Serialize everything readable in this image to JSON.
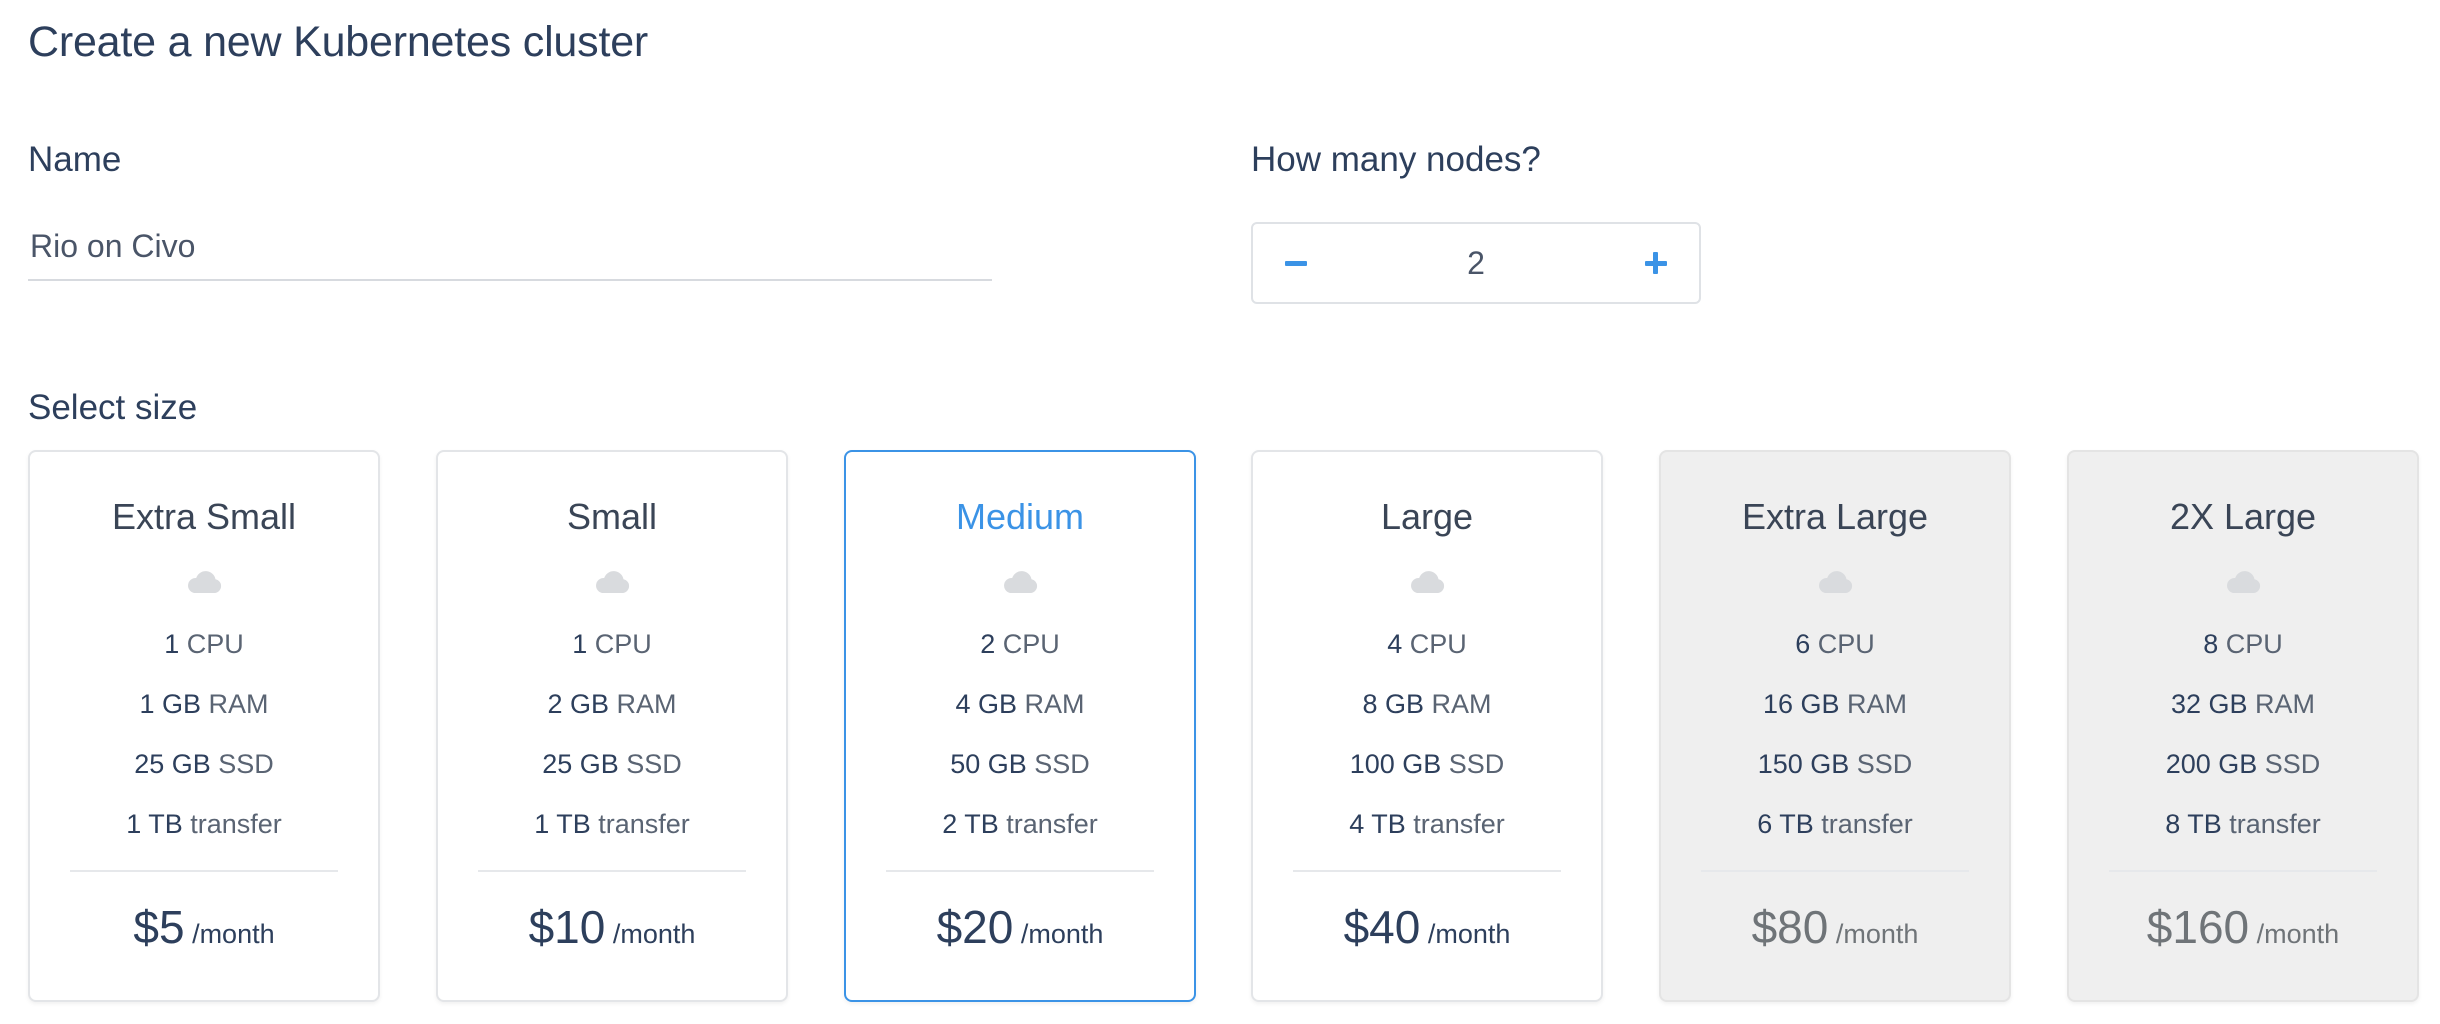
{
  "page": {
    "title": "Create a new Kubernetes cluster"
  },
  "name_field": {
    "label": "Name",
    "value": "Rio on Civo"
  },
  "nodes": {
    "label": "How many nodes?",
    "value": "2",
    "minus_icon": "minus-icon",
    "plus_icon": "plus-icon",
    "accent_color": "#3b93e6"
  },
  "sizes": {
    "label": "Select size",
    "selected": "Medium",
    "items": [
      {
        "name": "Extra Small",
        "cpu_num": "1",
        "cpu_unit": "CPU",
        "ram_num": "1 GB",
        "ram_unit": "RAM",
        "ssd_num": "25 GB",
        "ssd_unit": "SSD",
        "transfer_num": "1 TB",
        "transfer_unit": "transfer",
        "price": "$5",
        "period": "/month",
        "state": "available"
      },
      {
        "name": "Small",
        "cpu_num": "1",
        "cpu_unit": "CPU",
        "ram_num": "2 GB",
        "ram_unit": "RAM",
        "ssd_num": "25 GB",
        "ssd_unit": "SSD",
        "transfer_num": "1 TB",
        "transfer_unit": "transfer",
        "price": "$10",
        "period": "/month",
        "state": "available"
      },
      {
        "name": "Medium",
        "cpu_num": "2",
        "cpu_unit": "CPU",
        "ram_num": "4 GB",
        "ram_unit": "RAM",
        "ssd_num": "50 GB",
        "ssd_unit": "SSD",
        "transfer_num": "2 TB",
        "transfer_unit": "transfer",
        "price": "$20",
        "period": "/month",
        "state": "selected"
      },
      {
        "name": "Large",
        "cpu_num": "4",
        "cpu_unit": "CPU",
        "ram_num": "8 GB",
        "ram_unit": "RAM",
        "ssd_num": "100 GB",
        "ssd_unit": "SSD",
        "transfer_num": "4 TB",
        "transfer_unit": "transfer",
        "price": "$40",
        "period": "/month",
        "state": "available"
      },
      {
        "name": "Extra Large",
        "cpu_num": "6",
        "cpu_unit": "CPU",
        "ram_num": "16 GB",
        "ram_unit": "RAM",
        "ssd_num": "150 GB",
        "ssd_unit": "SSD",
        "transfer_num": "6 TB",
        "transfer_unit": "transfer",
        "price": "$80",
        "period": "/month",
        "state": "disabled"
      },
      {
        "name": "2X Large",
        "cpu_num": "8",
        "cpu_unit": "CPU",
        "ram_num": "32 GB",
        "ram_unit": "RAM",
        "ssd_num": "200 GB",
        "ssd_unit": "SSD",
        "transfer_num": "8 TB",
        "transfer_unit": "transfer",
        "price": "$160",
        "period": "/month",
        "state": "disabled"
      }
    ],
    "card_icon": "cloud-icon",
    "selected_color": "#3b93e6",
    "disabled_background": "#efefef"
  }
}
